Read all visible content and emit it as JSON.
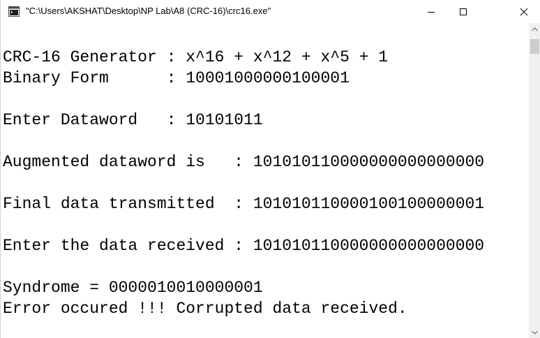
{
  "window": {
    "title": "\"C:\\Users\\AKSHAT\\Desktop\\NP Lab\\A8 (CRC-16)\\crc16.exe\"",
    "minimize_icon": "minimize-icon",
    "maximize_icon": "maximize-icon",
    "close_icon": "close-icon"
  },
  "console": {
    "lines": [
      "CRC-16 Generator : x^16 + x^12 + x^5 + 1",
      "Binary Form      : 10001000000100001",
      "Enter Dataword   : 10101011",
      "Augmented dataword is   : 101010110000000000000000",
      "Final data transmitted  : 101010110000100100000001",
      "Enter the data received : 101010110000000000000000",
      "Syndrome = 0000010010000001",
      "Error occured !!! Corrupted data received."
    ]
  }
}
